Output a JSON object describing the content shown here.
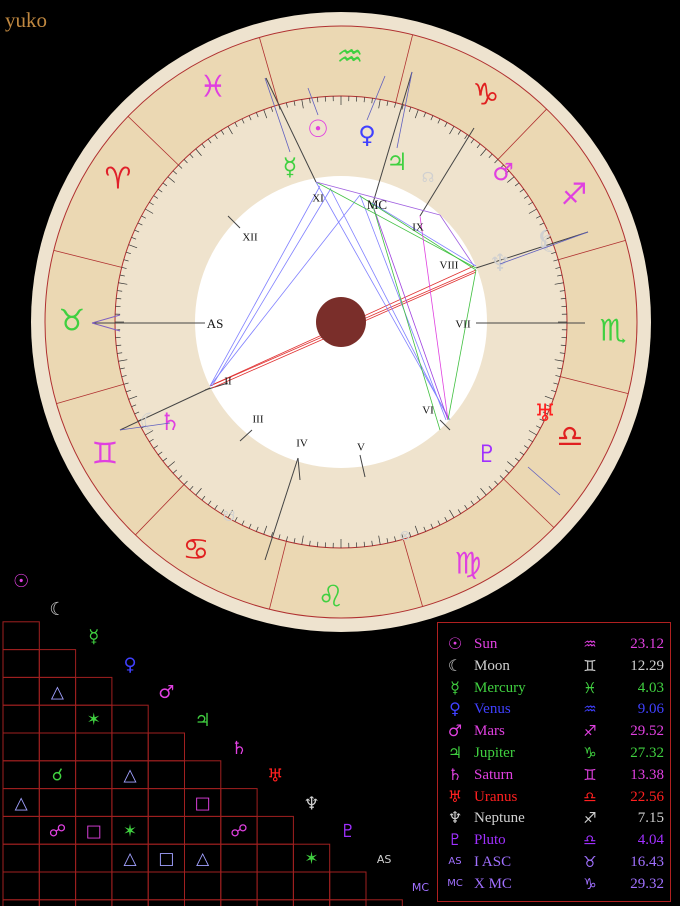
{
  "title": "yuko",
  "wheel": {
    "signs": [
      {
        "name": "aries",
        "glyph": "♈",
        "color": "#e0202a"
      },
      {
        "name": "taurus",
        "glyph": "♉",
        "color": "#40d040"
      },
      {
        "name": "gemini",
        "glyph": "♊",
        "color": "#e040e0"
      },
      {
        "name": "cancer",
        "glyph": "♋",
        "color": "#e02020"
      },
      {
        "name": "leo",
        "glyph": "♌",
        "color": "#40d040"
      },
      {
        "name": "virgo",
        "glyph": "♍",
        "color": "#e040e0"
      },
      {
        "name": "libra",
        "glyph": "♎",
        "color": "#e02020"
      },
      {
        "name": "scorpio",
        "glyph": "♏",
        "color": "#40d040"
      },
      {
        "name": "sagittarius",
        "glyph": "♐",
        "color": "#e040e0"
      },
      {
        "name": "capricorn",
        "glyph": "♑",
        "color": "#e02020"
      },
      {
        "name": "aquarius",
        "glyph": "♒",
        "color": "#40d040"
      },
      {
        "name": "pisces",
        "glyph": "♓",
        "color": "#e040e0"
      }
    ],
    "houses": [
      "AS",
      "II",
      "III",
      "IV",
      "V",
      "VI",
      "VII",
      "VIII",
      "IX",
      "MC",
      "XI",
      "XII"
    ],
    "planets": [
      {
        "name": "sun",
        "glyph": "☉",
        "color": "#e040e0"
      },
      {
        "name": "moon",
        "glyph": "☾",
        "color": "#d0d0d0"
      },
      {
        "name": "mercury",
        "glyph": "☿",
        "color": "#40d040"
      },
      {
        "name": "venus",
        "glyph": "♀",
        "color": "#4040ff"
      },
      {
        "name": "mars",
        "glyph": "♂",
        "color": "#e040e0"
      },
      {
        "name": "jupiter",
        "glyph": "♃",
        "color": "#40d040"
      },
      {
        "name": "saturn",
        "glyph": "♄",
        "color": "#e040e0"
      },
      {
        "name": "uranus",
        "glyph": "♅",
        "color": "#ff2020"
      },
      {
        "name": "neptune",
        "glyph": "♆",
        "color": "#d0d0d0"
      },
      {
        "name": "pluto",
        "glyph": "♇",
        "color": "#a030ff"
      },
      {
        "name": "node",
        "glyph": "☊",
        "color": "#d0d0d0"
      },
      {
        "name": "lilith",
        "glyph": "⚸",
        "color": "#d0d0d0"
      },
      {
        "name": "fortune",
        "glyph": "⊗",
        "color": "#d0d0d0"
      },
      {
        "name": "south-node",
        "glyph": "☋",
        "color": "#d0d0d0"
      },
      {
        "name": "moon2",
        "glyph": "☾",
        "color": "#d0d0d0"
      }
    ]
  },
  "aspect_grid": {
    "row_glyphs": [
      "☉",
      "☾",
      "☿",
      "♀",
      "♂",
      "♃",
      "♄",
      "♅",
      "♆",
      "♇",
      "AS",
      "MC"
    ],
    "row_colors": [
      "#e040e0",
      "#d0d0d0",
      "#40d040",
      "#4040ff",
      "#e040e0",
      "#40d040",
      "#e040e0",
      "#ff2020",
      "#d0d0d0",
      "#a030ff",
      "#d0d0d0",
      "#a070ff"
    ],
    "cells": [
      {
        "r": 3,
        "c": 1,
        "g": "△",
        "color": "#a0a0ff"
      },
      {
        "r": 4,
        "c": 2,
        "g": "✶",
        "color": "#40d040"
      },
      {
        "r": 6,
        "c": 1,
        "g": "☌",
        "color": "#40d040"
      },
      {
        "r": 6,
        "c": 3,
        "g": "△",
        "color": "#a0a0ff"
      },
      {
        "r": 7,
        "c": 0,
        "g": "△",
        "color": "#a0a0ff"
      },
      {
        "r": 7,
        "c": 5,
        "g": "□",
        "color": "#e040e0"
      },
      {
        "r": 8,
        "c": 1,
        "g": "☍",
        "color": "#e040e0"
      },
      {
        "r": 8,
        "c": 2,
        "g": "□",
        "color": "#e040e0"
      },
      {
        "r": 8,
        "c": 3,
        "g": "✶",
        "color": "#40d040"
      },
      {
        "r": 8,
        "c": 6,
        "g": "☍",
        "color": "#e040e0"
      },
      {
        "r": 9,
        "c": 3,
        "g": "△",
        "color": "#a0a0ff"
      },
      {
        "r": 9,
        "c": 4,
        "g": "□",
        "color": "#a0a0ff"
      },
      {
        "r": 9,
        "c": 5,
        "g": "△",
        "color": "#a0a0ff"
      },
      {
        "r": 9,
        "c": 8,
        "g": "✶",
        "color": "#40d040"
      },
      {
        "r": 11,
        "c": 3,
        "g": "☌",
        "color": "#40d040"
      },
      {
        "r": 11,
        "c": 5,
        "g": "☌",
        "color": "#40d040"
      },
      {
        "r": 11,
        "c": 9,
        "g": "△",
        "color": "#a0a0ff"
      }
    ]
  },
  "legend": [
    {
      "glyph": "☉",
      "name": "Sun",
      "sign": "♒",
      "degree": "23.12",
      "color": "#e040e0"
    },
    {
      "glyph": "☾",
      "name": "Moon",
      "sign": "♊",
      "degree": "12.29",
      "color": "#d0d0d0"
    },
    {
      "glyph": "☿",
      "name": "Mercury",
      "sign": "♓",
      "degree": "4.03",
      "color": "#40d040"
    },
    {
      "glyph": "♀",
      "name": "Venus",
      "sign": "♒",
      "degree": "9.06",
      "color": "#4040ff"
    },
    {
      "glyph": "♂",
      "name": "Mars",
      "sign": "♐",
      "degree": "29.52",
      "color": "#e040e0"
    },
    {
      "glyph": "♃",
      "name": "Jupiter",
      "sign": "♑",
      "degree": "27.32",
      "color": "#40d040"
    },
    {
      "glyph": "♄",
      "name": "Saturn",
      "sign": "♊",
      "degree": "13.38",
      "color": "#e040e0"
    },
    {
      "glyph": "♅",
      "name": "Uranus",
      "sign": "♎",
      "degree": "22.56",
      "color": "#ff2020"
    },
    {
      "glyph": "♆",
      "name": "Neptune",
      "sign": "♐",
      "degree": "7.15",
      "color": "#d0d0d0"
    },
    {
      "glyph": "♇",
      "name": "Pluto",
      "sign": "♎",
      "degree": "4.04",
      "color": "#a030ff"
    },
    {
      "glyph": "AS",
      "name": "I ASC",
      "sign": "♉",
      "degree": "16.43",
      "color": "#a070ff"
    },
    {
      "glyph": "MC",
      "name": "X MC",
      "sign": "♑",
      "degree": "29.32",
      "color": "#a070ff"
    }
  ]
}
